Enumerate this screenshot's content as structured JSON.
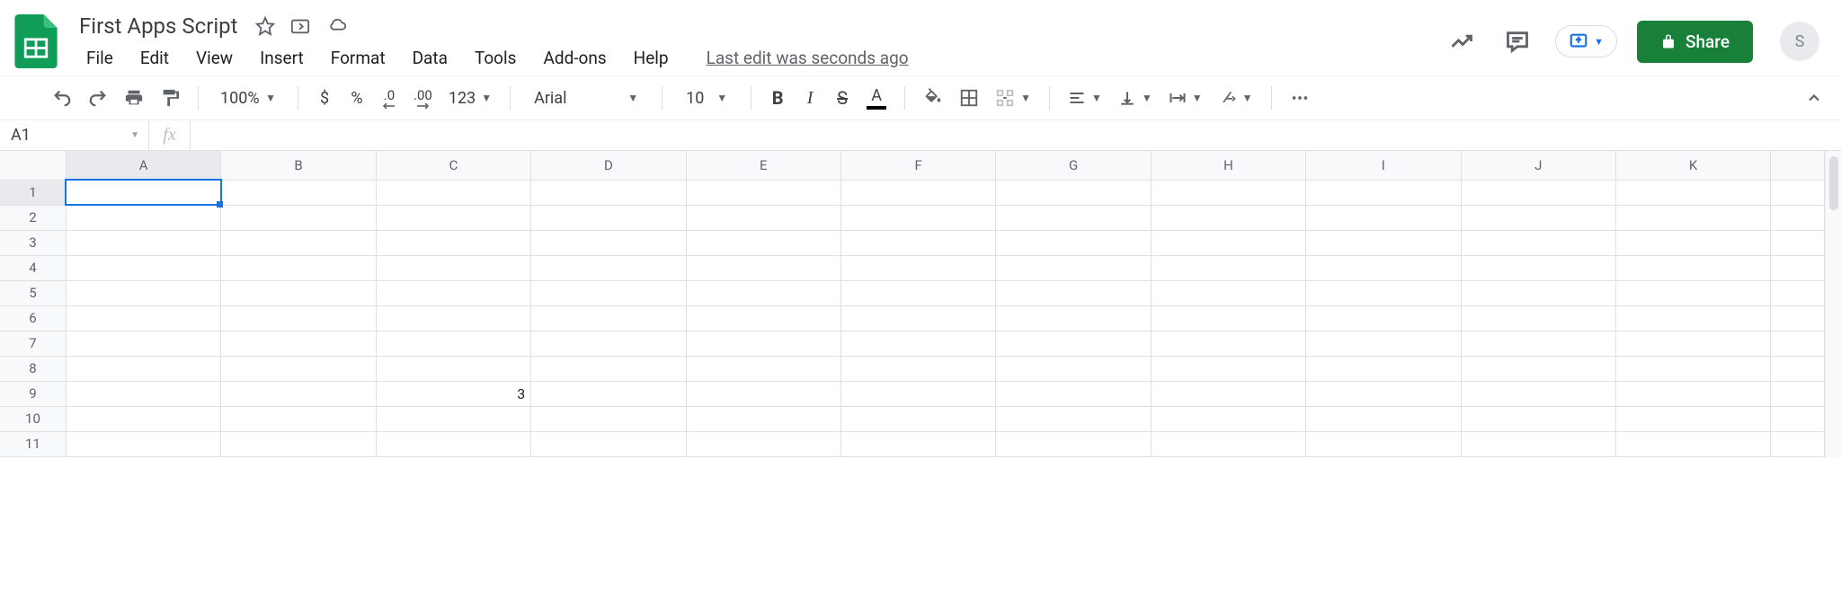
{
  "header": {
    "doc_title": "First Apps Script",
    "last_edit": "Last edit was seconds ago",
    "share_label": "Share",
    "avatar_initial": "S"
  },
  "menubar": {
    "items": [
      "File",
      "Edit",
      "View",
      "Insert",
      "Format",
      "Data",
      "Tools",
      "Add-ons",
      "Help"
    ]
  },
  "toolbar": {
    "zoom": "100%",
    "currency": "$",
    "percent": "%",
    "dec_decrease": ".0",
    "dec_increase": ".00",
    "more_formats": "123",
    "font_name": "Arial",
    "font_size": "10"
  },
  "formula_bar": {
    "name_box": "A1",
    "fx_label": "fx",
    "formula_value": ""
  },
  "grid": {
    "columns": [
      "A",
      "B",
      "C",
      "D",
      "E",
      "F",
      "G",
      "H",
      "I",
      "J",
      "K"
    ],
    "row_count": 11,
    "selected_cell": "A1",
    "cells": {
      "C9": "3"
    }
  }
}
